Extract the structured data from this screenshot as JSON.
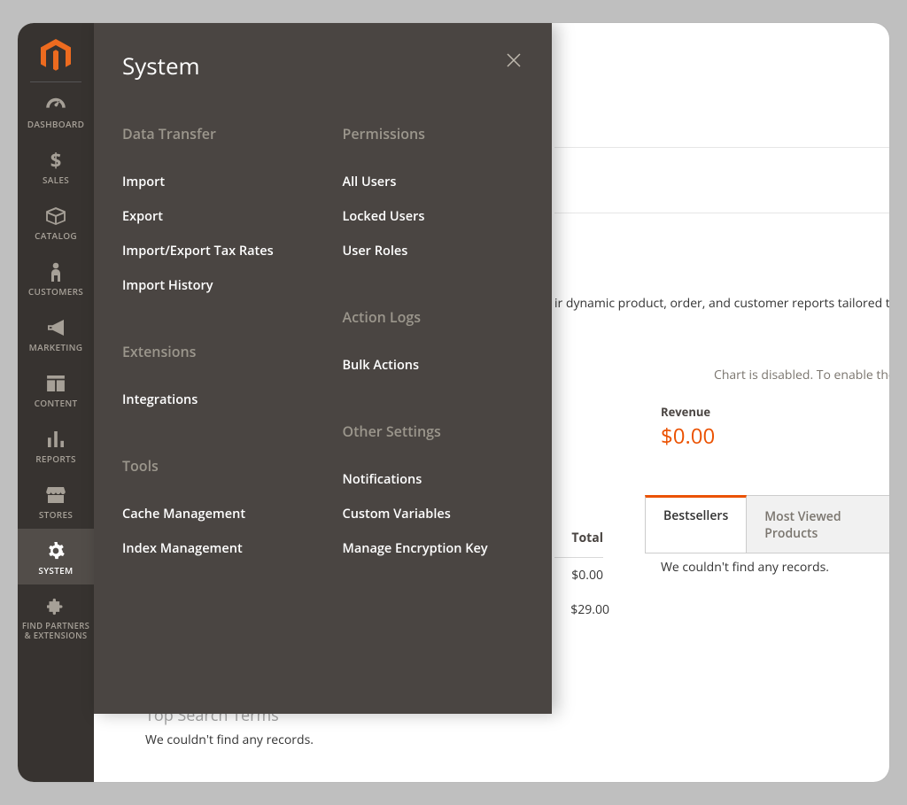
{
  "sidebar": {
    "items": [
      {
        "label": "DASHBOARD"
      },
      {
        "label": "SALES"
      },
      {
        "label": "CATALOG"
      },
      {
        "label": "CUSTOMERS"
      },
      {
        "label": "MARKETING"
      },
      {
        "label": "CONTENT"
      },
      {
        "label": "REPORTS"
      },
      {
        "label": "STORES"
      },
      {
        "label": "SYSTEM"
      },
      {
        "label": "FIND PARTNERS & EXTENSIONS"
      }
    ]
  },
  "flyout": {
    "title": "System",
    "left": [
      {
        "heading": "Data Transfer",
        "items": [
          "Import",
          "Export",
          "Import/Export Tax Rates",
          "Import History"
        ]
      },
      {
        "heading": "Extensions",
        "items": [
          "Integrations"
        ]
      },
      {
        "heading": "Tools",
        "items": [
          "Cache Management",
          "Index Management"
        ]
      }
    ],
    "right": [
      {
        "heading": "Permissions",
        "items": [
          "All Users",
          "Locked Users",
          "User Roles"
        ]
      },
      {
        "heading": "Action Logs",
        "items": [
          "Bulk Actions"
        ]
      },
      {
        "heading": "Other Settings",
        "items": [
          "Notifications",
          "Custom Variables",
          "Manage Encryption Key"
        ]
      }
    ]
  },
  "main": {
    "bi_text": "ir dynamic product, order, and customer reports tailored t",
    "chart_note": "Chart is disabled. To enable the chart, click",
    "kpi": {
      "label": "Revenue",
      "value": "$0.00"
    },
    "tabs": {
      "active": "Bestsellers",
      "other": "Most Viewed Products"
    },
    "no_records": "We couldn't find any records.",
    "table": {
      "header": "Total",
      "rows": [
        "$0.00",
        "$29.00"
      ]
    },
    "lower": {
      "title": "Top Search Terms",
      "msg": "We couldn't find any records."
    }
  }
}
